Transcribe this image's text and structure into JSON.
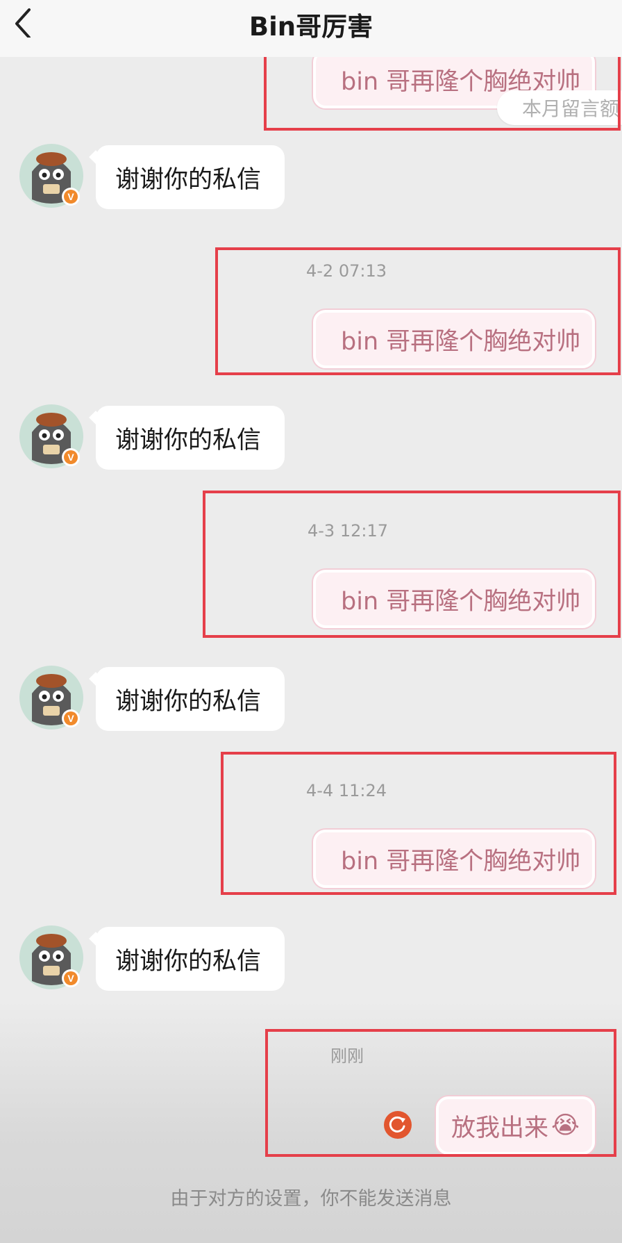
{
  "header": {
    "title": "Bin哥厉害",
    "back_icon": "chevron-left-icon"
  },
  "monthly_badge": "本月留言额",
  "incoming_message": "谢谢你的私信",
  "messages": [
    {
      "timestamp": "",
      "text": "bin 哥再隆个胸绝对帅"
    },
    {
      "timestamp": "4-2 07:13",
      "text": "bin 哥再隆个胸绝对帅"
    },
    {
      "timestamp": "4-3 12:17",
      "text": "bin 哥再隆个胸绝对帅"
    },
    {
      "timestamp": "4-4 11:24",
      "text": "bin 哥再隆个胸绝对帅"
    }
  ],
  "last_message": {
    "timestamp": "刚刚",
    "text": "放我出来",
    "emoji": "😭",
    "status_icon": "retry-icon"
  },
  "footer_notice": "由于对方的设置，你不能发送消息",
  "colors": {
    "highlight_box": "#e53f4a",
    "bubble_text": "#b87080",
    "bubble_bg": "#fdf0f3",
    "badge_orange": "#f18a2b",
    "retry_red": "#e2562f"
  }
}
